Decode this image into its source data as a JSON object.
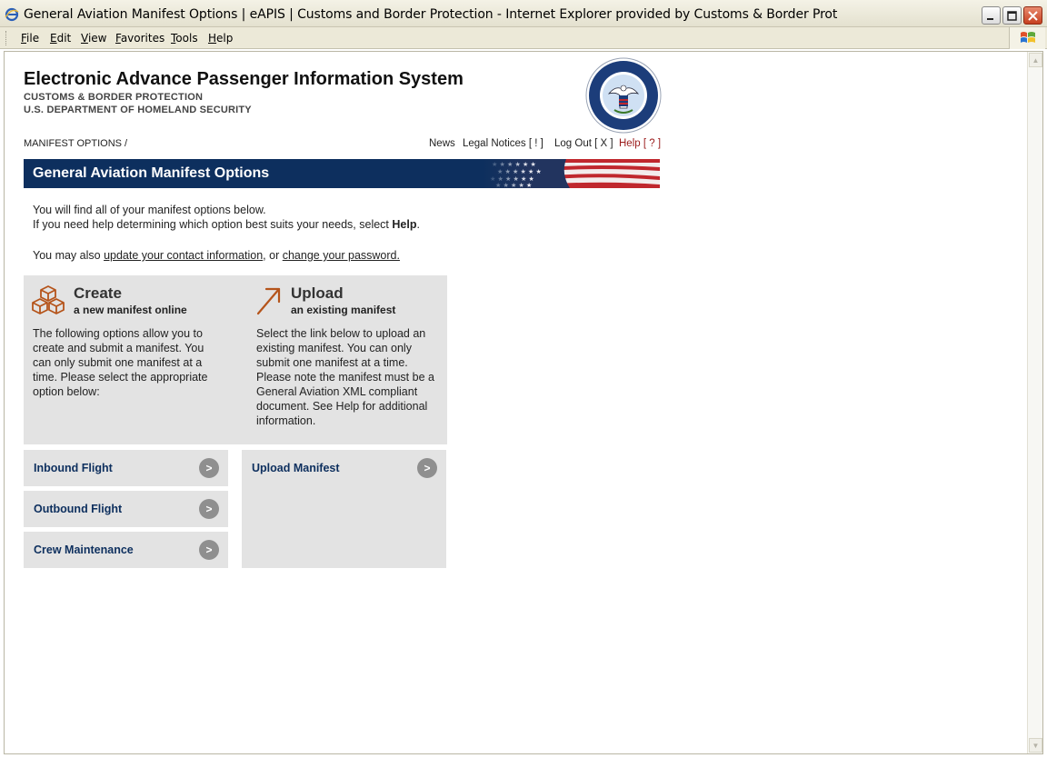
{
  "window": {
    "title": "General Aviation Manifest Options | eAPIS | Customs and Border Protection - Internet Explorer provided by Customs & Border Prot"
  },
  "menu": {
    "items": [
      {
        "label": "File",
        "underline": "F",
        "rest": "ile"
      },
      {
        "label": "Edit",
        "underline": "E",
        "rest": "dit"
      },
      {
        "label": "View",
        "underline": "V",
        "rest": "iew"
      },
      {
        "label": "Favorites",
        "underline": "F",
        "rest": "avorites"
      },
      {
        "label": "Tools",
        "underline": "T",
        "rest": "ools"
      },
      {
        "label": "Help",
        "underline": "H",
        "rest": "elp"
      }
    ]
  },
  "header": {
    "title": "Electronic Advance Passenger Information System",
    "subtitle1": "CUSTOMS & BORDER PROTECTION",
    "subtitle2": "U.S. DEPARTMENT OF HOMELAND SECURITY",
    "seal_text": "U.S. DEPARTMENT OF HOMELAND SECURITY"
  },
  "breadcrumb": "MANIFEST OPTIONS /",
  "toplinks": {
    "news": "News",
    "legal": "Legal Notices [ ! ]",
    "logout": "Log Out [ X ]",
    "help": "Help [ ? ]"
  },
  "banner": {
    "title": "General Aviation Manifest Options"
  },
  "intro": {
    "line1": "You will find all of your manifest options below.",
    "line2_prefix": "If you need help determining which option best suits your needs, select ",
    "line2_bold": "Help",
    "line2_suffix": ".",
    "line3_prefix": "You may also ",
    "contact_link": "update your contact information",
    "line3_mid": ", or ",
    "password_link": "change your password."
  },
  "create": {
    "title": "Create",
    "subtitle": "a new manifest online",
    "description": "The following options allow you to create and submit a manifest. You can only submit one manifest at a time. Please select the appropriate option below:"
  },
  "upload": {
    "title": "Upload",
    "subtitle": "an existing manifest",
    "description": "Select the link below to upload an existing manifest. You can only submit one manifest at a time. Please note the manifest must be a General Aviation XML compliant document. See Help for additional information."
  },
  "actions": {
    "inbound": "Inbound Flight",
    "outbound": "Outbound Flight",
    "crew": "Crew Maintenance",
    "upload": "Upload Manifest",
    "go_glyph": ">"
  },
  "colors": {
    "banner": "#0d2f5e",
    "panel": "#e3e3e3",
    "help_link": "#9b1b1b",
    "icon_orange": "#b5541b"
  }
}
